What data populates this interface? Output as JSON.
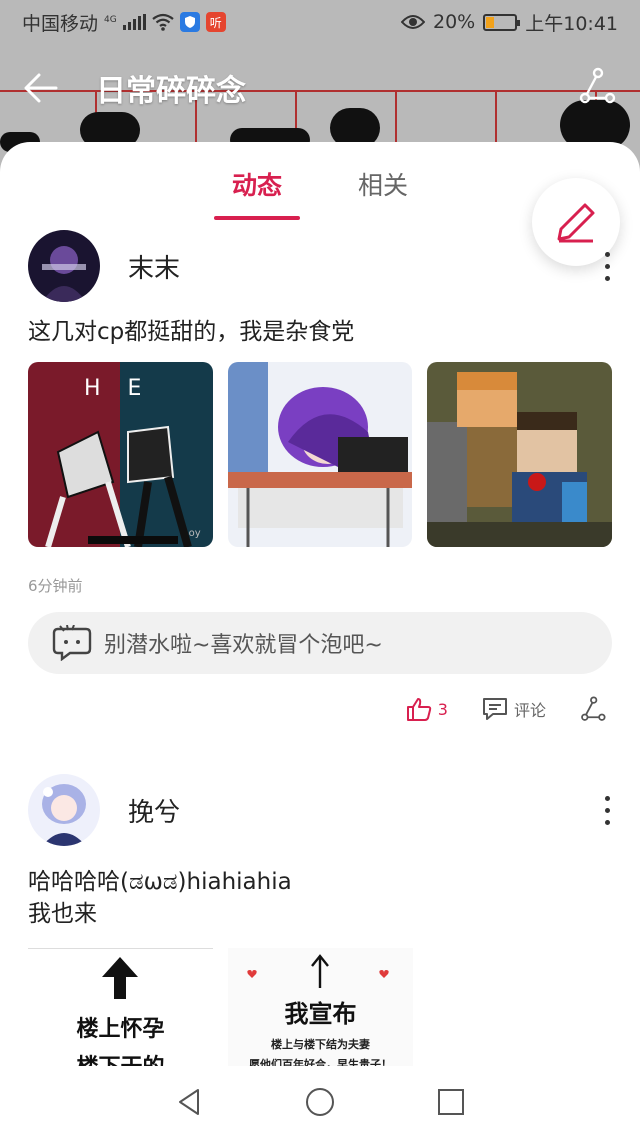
{
  "status": {
    "carrier": "中国移动",
    "network": "4G",
    "battery": "20%",
    "time": "上午10:41",
    "badge_listen": "听",
    "colors": {
      "battery": "#f2a21b"
    }
  },
  "header": {
    "title": "日常碎碎念",
    "back_icon": "arrow-left-icon",
    "share_icon": "share-icon"
  },
  "tabs": [
    {
      "label": "动态",
      "active": true
    },
    {
      "label": "相关",
      "active": false
    }
  ],
  "fab": {
    "icon": "pencil-icon"
  },
  "posts": [
    {
      "user": "末末",
      "text": "这几对cp都挺甜的，我是杂食党",
      "time": "6分钟前",
      "comment_placeholder": "别潜水啦~喜欢就冒个泡吧~",
      "likes": "3",
      "comment_label": "评论",
      "images": [
        {
          "caption_letters": "H E",
          "signature": "oy"
        },
        {},
        {}
      ]
    },
    {
      "user": "挽兮",
      "text_line1": "哈哈哈哈(ಡωಡ)hiahiahia",
      "text_line2": "我也来",
      "images": [
        {
          "line1": "楼上怀孕",
          "line2": "楼下干的"
        },
        {
          "headline": "我宣布",
          "line1": "楼上与楼下结为夫妻",
          "line2": "愿他们百年好合，早生贵子！"
        }
      ]
    }
  ],
  "accent_color": "#d8204f"
}
